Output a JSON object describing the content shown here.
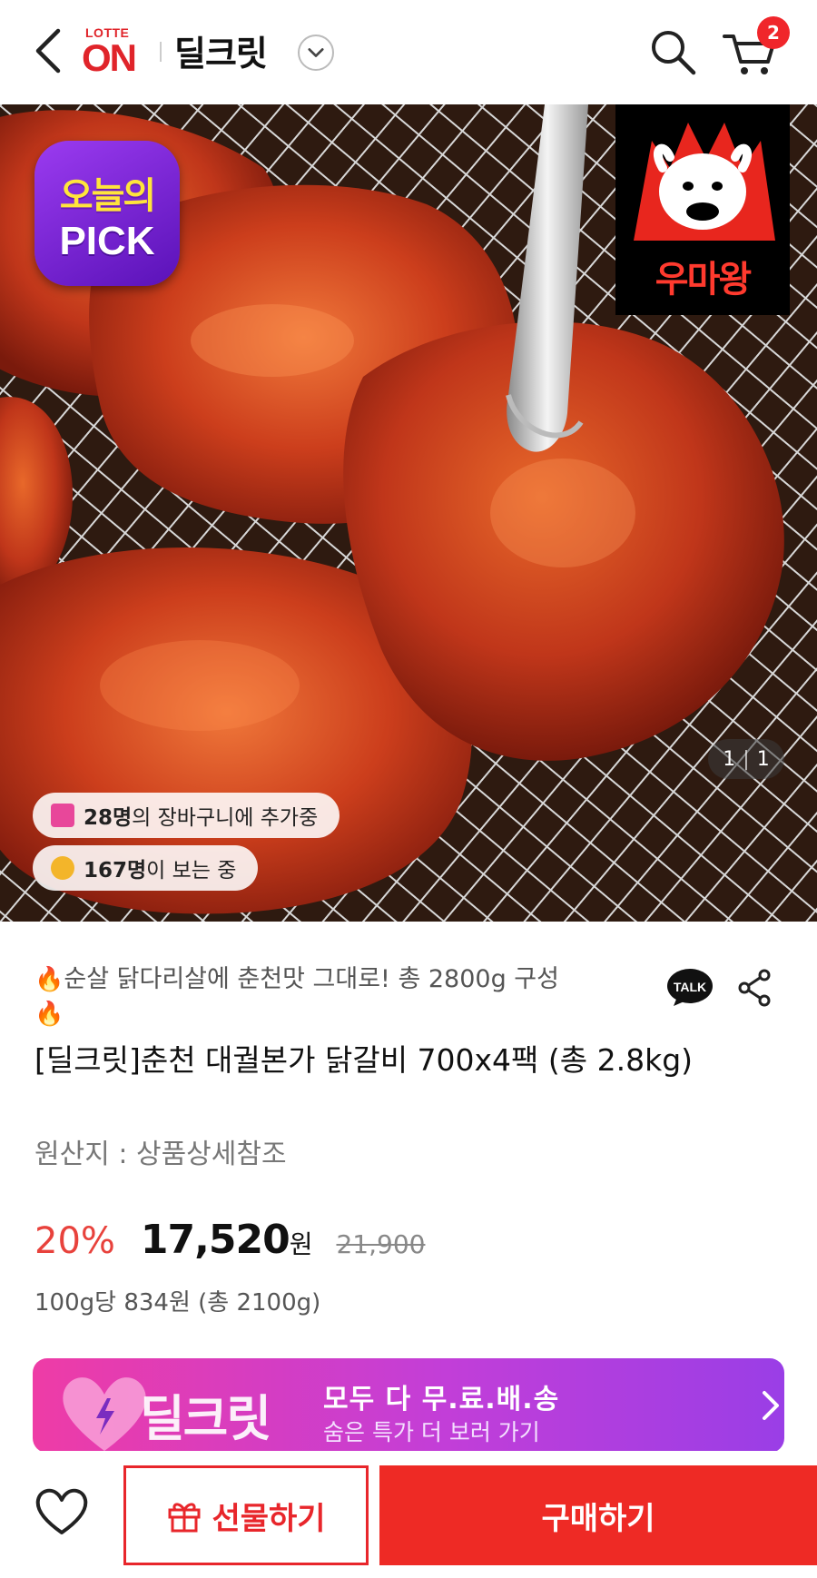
{
  "header": {
    "logo_small": "LOTTE",
    "logo_big": "ON",
    "brand_title": "딜크릿",
    "cart_count": "2",
    "icons": [
      "back-icon",
      "chevron-down-icon",
      "search-icon",
      "cart-icon"
    ]
  },
  "hero": {
    "pick_line1": "오늘의",
    "pick_line2": "PICK",
    "brand_badge_name": "우마왕",
    "cart_social": {
      "count": "28명",
      "text": "의 장바구니에 추가중"
    },
    "view_social": {
      "count": "167명",
      "text": "이 보는 중"
    },
    "page_current": "1",
    "page_total": "1"
  },
  "product": {
    "subtitle": "순살 닭다리살에 춘천맛 그대로! 총 2800g 구성",
    "title": "[딜크릿]춘천 대궐본가 닭갈비 700x4팩 (총 2.8kg)",
    "origin": "원산지 : 상품상세참조",
    "discount": "20%",
    "price": "17,520",
    "currency": "원",
    "original_price": "21,900",
    "unit_price": "100g당 834원 (총 2100g)",
    "talk_label": "TALK"
  },
  "promo": {
    "brand": "딜크릿",
    "line1": "모두 다 무.료.배.송",
    "line2": "숨은 특가 더 보러 가기"
  },
  "bottom": {
    "gift_label": "선물하기",
    "buy_label": "구매하기"
  },
  "colors": {
    "brand_red": "#e0242a",
    "discount_red": "#e8423c",
    "buy_red": "#ee2a25",
    "promo_pink": "#ee3ca6",
    "promo_purple": "#9a3ee6",
    "pick_purple": "#7a22d6"
  }
}
